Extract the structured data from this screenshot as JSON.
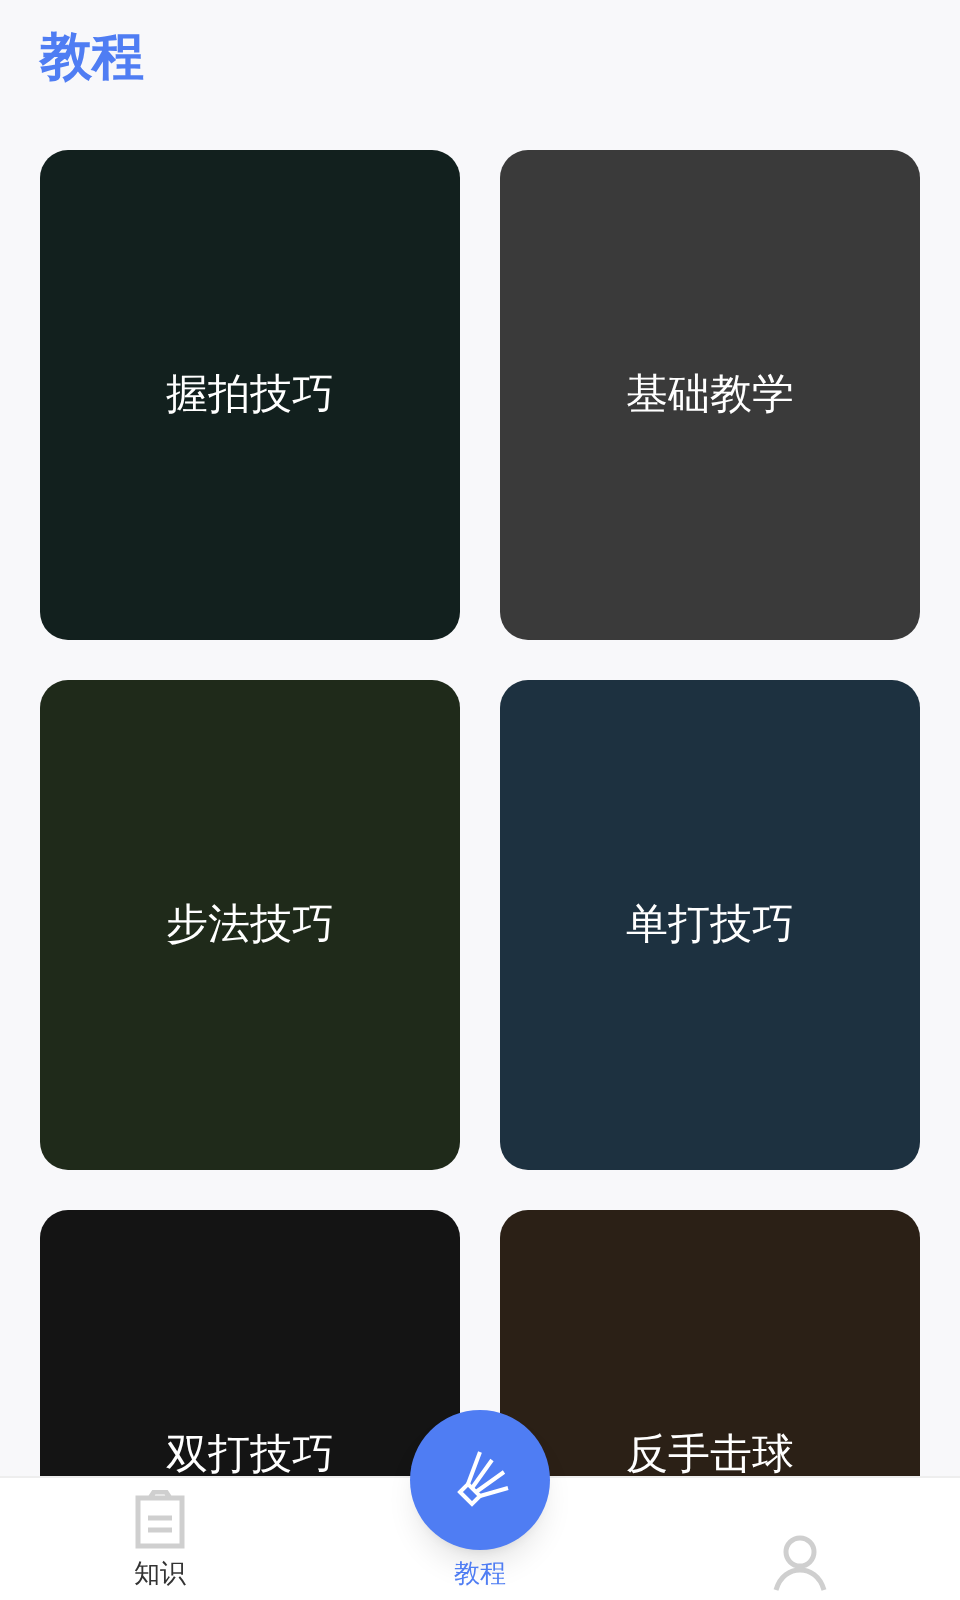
{
  "header": {
    "title": "教程"
  },
  "cards": [
    {
      "label": "握拍技巧"
    },
    {
      "label": "基础教学"
    },
    {
      "label": "步法技巧"
    },
    {
      "label": "单打技巧"
    },
    {
      "label": "双打技巧"
    },
    {
      "label": "反手击球"
    }
  ],
  "nav": [
    {
      "kind": "clipboard",
      "label": "知识",
      "selected": false
    },
    {
      "kind": "shuttlecock",
      "label": "教程",
      "selected": true
    },
    {
      "kind": "person",
      "selected": false
    }
  ]
}
